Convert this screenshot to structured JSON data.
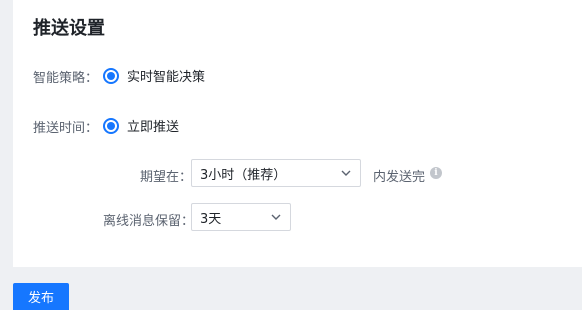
{
  "title": "推送设置",
  "strategy": {
    "label": "智能策略：",
    "option": "实时智能决策",
    "selected": true
  },
  "push_time": {
    "label": "推送时间：",
    "option": "立即推送",
    "selected": true
  },
  "expect": {
    "label": "期望在：",
    "value": "3小时（推荐）",
    "suffix": "内发送完"
  },
  "retention": {
    "label": "离线消息保留：",
    "value": "3天"
  },
  "publish_button": "发布",
  "accent_color": "#1677ff",
  "icons": {
    "info": "info-icon",
    "dropdown": "chevron-down-icon"
  }
}
